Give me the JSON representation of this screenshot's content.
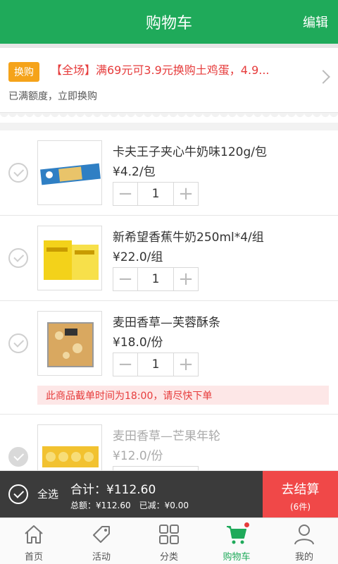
{
  "header": {
    "title": "购物车",
    "edit_label": "编辑"
  },
  "promo": {
    "tag": "换购",
    "text": "【全场】满69元可3.9元换购土鸡蛋，4.9...",
    "subtext": "已满额度，立即换购"
  },
  "items": [
    {
      "name": "卡夫王子夹心牛奶味120g/包",
      "price": "¥4.2/包",
      "quantity": "1",
      "minus": "−",
      "plus": "+"
    },
    {
      "name": "新希望香蕉牛奶250ml*4/组",
      "price": "¥22.0/组",
      "quantity": "1",
      "minus": "−",
      "plus": "+"
    },
    {
      "name": "麦田香草—芙蓉酥条",
      "price": "¥18.0/份",
      "quantity": "1",
      "minus": "−",
      "plus": "+",
      "notice": "此商品截单时间为18:00，请尽快下单"
    },
    {
      "name": "麦田香草—芒果年轮",
      "price": "¥12.0/份"
    }
  ],
  "bottom_bar": {
    "select_all_label": "全选",
    "total": "合计：¥112.60",
    "summary": "总额：¥112.60　已减：¥0.00",
    "checkout_label": "去结算",
    "checkout_count": "(6件)"
  },
  "tabs": [
    {
      "label": "首页",
      "icon": "home-icon"
    },
    {
      "label": "活动",
      "icon": "tag-icon"
    },
    {
      "label": "分类",
      "icon": "grid-icon"
    },
    {
      "label": "购物车",
      "icon": "cart-icon",
      "active": true
    },
    {
      "label": "我的",
      "icon": "user-icon"
    }
  ],
  "colors": {
    "primary": "#1faa5a",
    "accent": "#f04848",
    "promo_tag": "#f5a31a",
    "bar": "#3b3b3b"
  }
}
